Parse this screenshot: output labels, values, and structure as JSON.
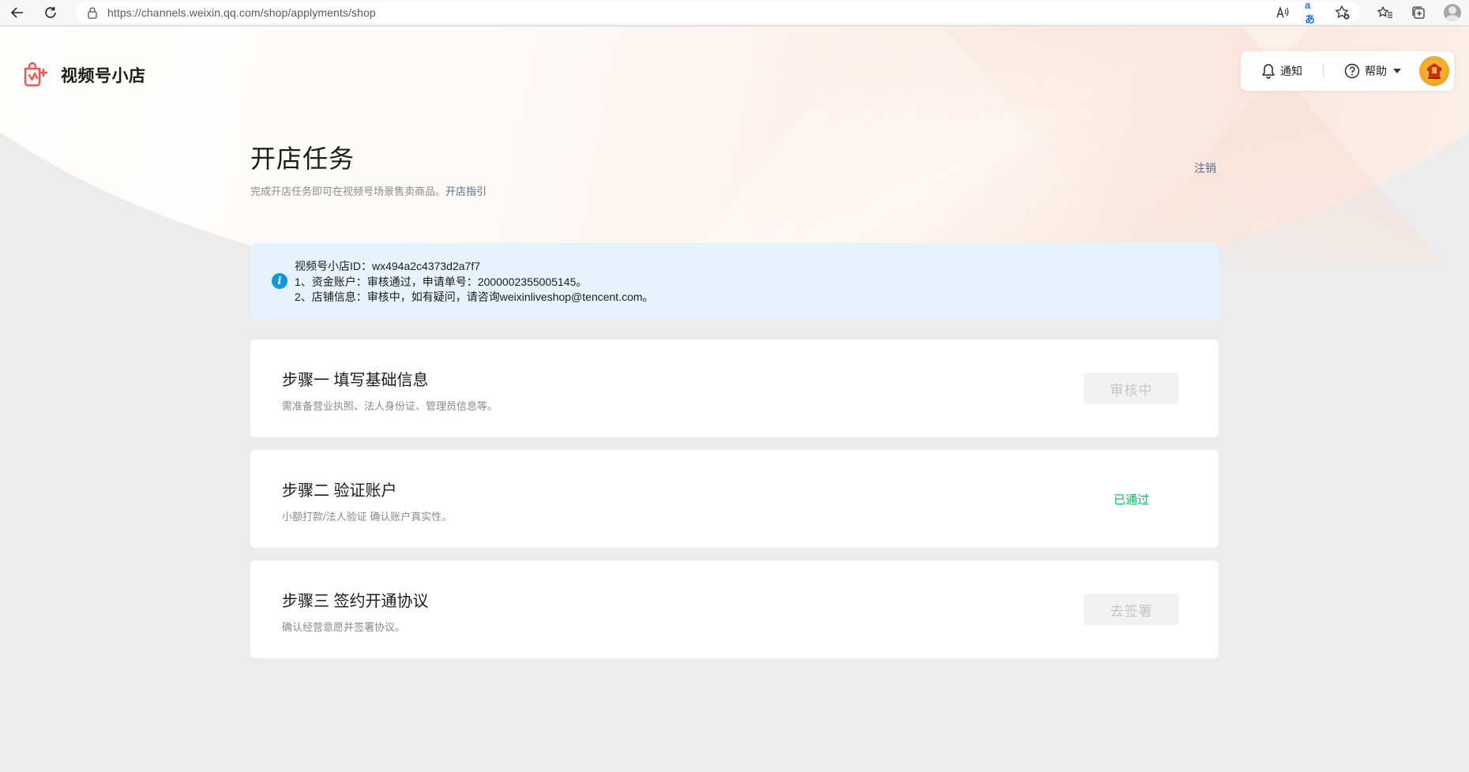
{
  "browser": {
    "url": "https://channels.weixin.qq.com/shop/applyments/shop",
    "translate_label": "aあ"
  },
  "brand": {
    "name": "视频号小店",
    "accent_color": "#fa5151"
  },
  "top_actions": {
    "notify_label": "通知",
    "help_label": "帮助"
  },
  "header": {
    "title": "开店任务",
    "subtitle": "完成开店任务即可在视频号场景售卖商品。",
    "guide_link": "开店指引",
    "logout": "注销"
  },
  "info": {
    "line1": "视频号小店ID：wx494a2c4373d2a7f7",
    "line2": "1、资金账户：审核通过，申请单号：2000002355005145。",
    "line3": "2、店铺信息：审核中，如有疑问，请咨询weixinliveshop@tencent.com。"
  },
  "steps": [
    {
      "title": "步骤一 填写基础信息",
      "desc": "需准备营业执照、法人身份证、管理员信息等。",
      "action": "审核中"
    },
    {
      "title": "步骤二 验证账户",
      "desc": "小额打款/法人验证 确认账户真实性。",
      "action": "已通过",
      "action_color": "#07c160"
    },
    {
      "title": "步骤三 签约开通协议",
      "desc": "确认经营意愿并签署协议。",
      "action": "去签署"
    }
  ]
}
